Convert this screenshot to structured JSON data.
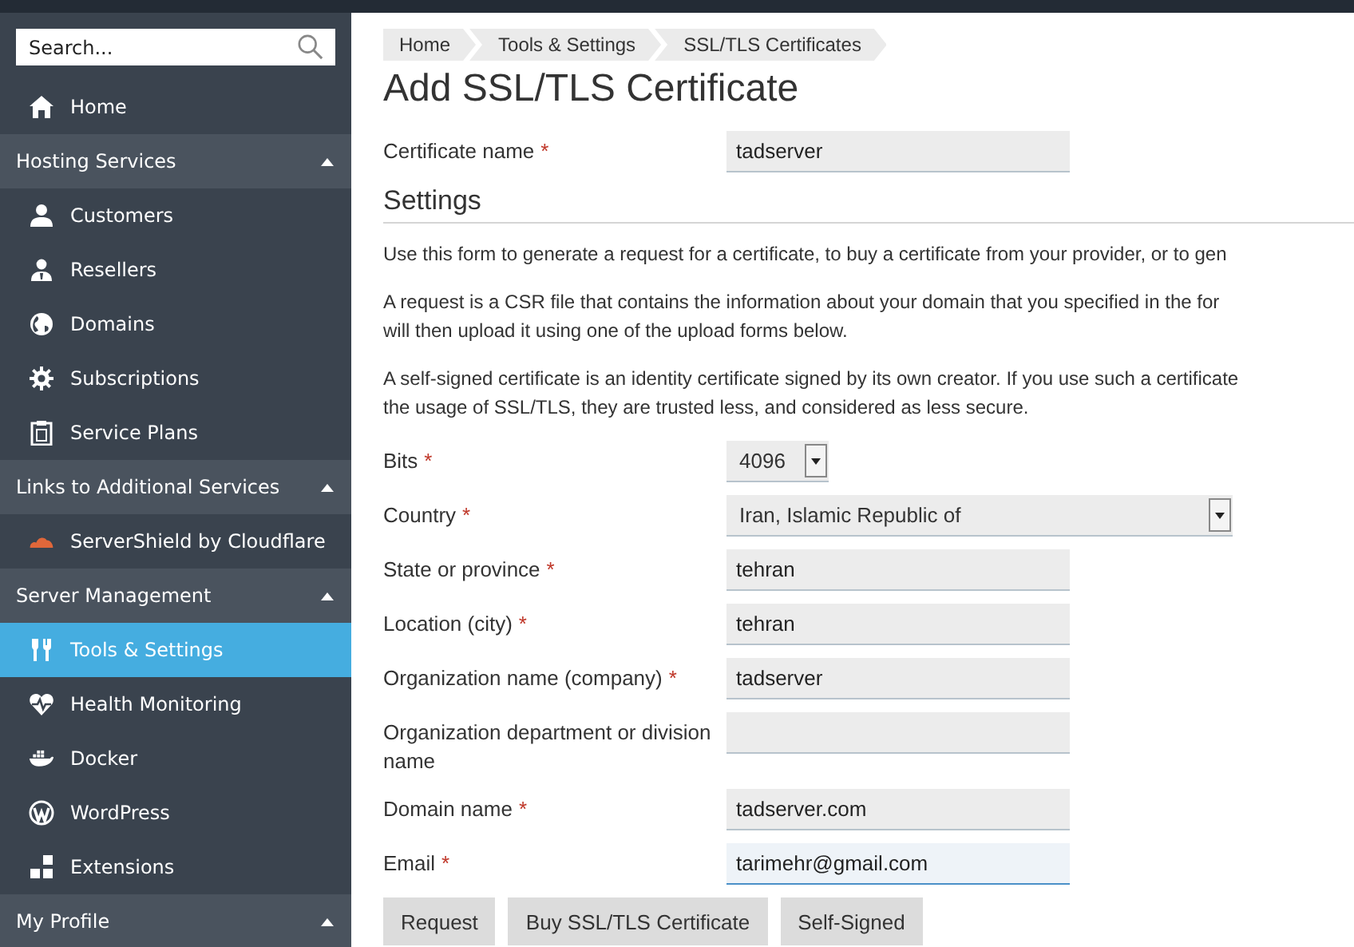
{
  "sidebar": {
    "search": {
      "placeholder": "Search..."
    },
    "top_items": [
      {
        "label": "Home",
        "selected": false
      }
    ],
    "sections": [
      {
        "title": "Hosting Services",
        "expanded": true,
        "items": [
          {
            "label": "Customers",
            "selected": false
          },
          {
            "label": "Resellers",
            "selected": false
          },
          {
            "label": "Domains",
            "selected": false
          },
          {
            "label": "Subscriptions",
            "selected": false
          },
          {
            "label": "Service Plans",
            "selected": false
          }
        ]
      },
      {
        "title": "Links to Additional Services",
        "expanded": true,
        "items": [
          {
            "label": "ServerShield by Cloudflare",
            "selected": false
          }
        ]
      },
      {
        "title": "Server Management",
        "expanded": true,
        "items": [
          {
            "label": "Tools & Settings",
            "selected": true
          },
          {
            "label": "Health Monitoring",
            "selected": false
          },
          {
            "label": "Docker",
            "selected": false
          },
          {
            "label": "WordPress",
            "selected": false
          },
          {
            "label": "Extensions",
            "selected": false
          }
        ]
      },
      {
        "title": "My Profile",
        "expanded": true
      }
    ]
  },
  "breadcrumbs": [
    "Home",
    "Tools & Settings",
    "SSL/TLS Certificates"
  ],
  "title": "Add SSL/TLS Certificate",
  "name_field": {
    "kind": "text",
    "label": "Certificate name",
    "marker": "*",
    "value": "tadserver",
    "focused": false
  },
  "settings_heading": "Settings",
  "paragraphs": [
    {
      "lines": [
        "Use this form to generate a request for a certificate, to buy a certificate from your provider, or to gen"
      ]
    },
    {
      "lines": [
        "A request is a CSR file that contains the information about your domain that you specified in the for",
        "will then upload it using one of the upload forms below."
      ]
    },
    {
      "lines": [
        "A self-signed certificate is an identity certificate signed by its own creator. If you use such a certificate",
        "the usage of SSL/TLS, they are trusted less, and considered as less secure."
      ]
    }
  ],
  "fields": [
    {
      "kind": "select-short",
      "label": "Bits",
      "marker": "*",
      "value": "4096",
      "focused": false
    },
    {
      "kind": "select-wide",
      "label": "Country",
      "marker": "*",
      "value": "Iran, Islamic Republic of",
      "focused": false
    },
    {
      "kind": "text",
      "label": "State or province",
      "marker": "*",
      "value": "tehran",
      "focused": false
    },
    {
      "kind": "text",
      "label": "Location (city)",
      "marker": "*",
      "value": "tehran",
      "focused": false
    },
    {
      "kind": "text",
      "label": "Organization name (company)",
      "marker": "*",
      "value": "tadserver",
      "focused": false
    },
    {
      "kind": "text",
      "label": "Organization department or division name",
      "focused": false
    },
    {
      "kind": "text",
      "label": "Domain name",
      "marker": "*",
      "value": "tadserver.com",
      "focused": false
    },
    {
      "kind": "text",
      "label": "Email",
      "marker": "*",
      "value": "tarimehr@gmail.com",
      "focused": true
    }
  ],
  "buttons": [
    "Request",
    "Buy SSL/TLS Certificate",
    "Self-Signed"
  ]
}
